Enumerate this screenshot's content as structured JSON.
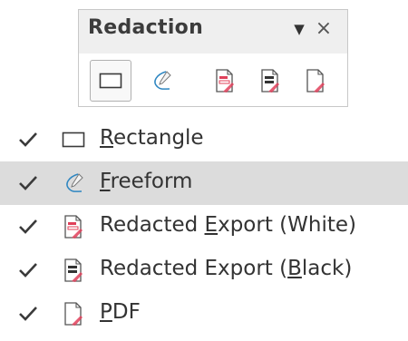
{
  "toolbar": {
    "title": "Redaction",
    "buttons": [
      {
        "icon": "rectangle-icon",
        "active": true
      },
      {
        "icon": "freeform-icon",
        "active": false
      },
      {
        "icon": "redacted-export-white-icon",
        "active": false
      },
      {
        "icon": "redacted-export-black-icon",
        "active": false
      },
      {
        "icon": "pdf-icon",
        "active": false
      }
    ]
  },
  "menu": {
    "items": [
      {
        "pre": "",
        "mn": "R",
        "post": "ectangle",
        "checked": true,
        "icon": "rectangle-icon",
        "highlighted": false
      },
      {
        "pre": "",
        "mn": "F",
        "post": "reeform",
        "checked": true,
        "icon": "freeform-icon",
        "highlighted": true
      },
      {
        "pre": "Redacted ",
        "mn": "E",
        "post": "xport (White)",
        "checked": true,
        "icon": "redacted-export-white-icon",
        "highlighted": false
      },
      {
        "pre": "Redacted Export (",
        "mn": "B",
        "post": "lack)",
        "checked": true,
        "icon": "redacted-export-black-icon",
        "highlighted": false
      },
      {
        "pre": "",
        "mn": "P",
        "post": "DF",
        "checked": true,
        "icon": "pdf-icon",
        "highlighted": false
      }
    ]
  },
  "colors": {
    "highlight": "#dcdcdc",
    "accent_red": "#e0405a",
    "freeform_blue": "#2e86c1"
  }
}
